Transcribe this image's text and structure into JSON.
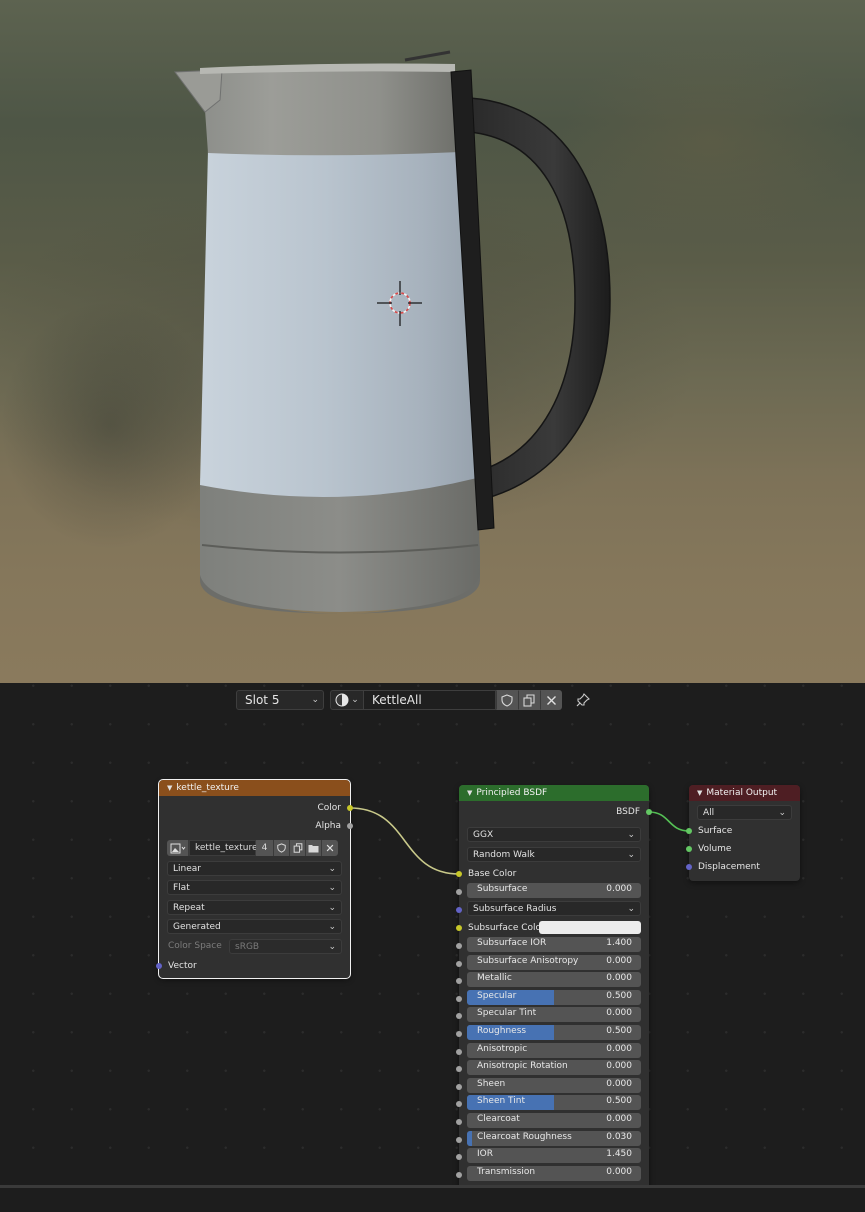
{
  "header": {
    "slot_label": "Slot 5",
    "material_name": "KettleAll"
  },
  "icons": {
    "material": "material-sphere-icon",
    "fake_user": "shield-icon",
    "duplicate": "duplicate-icon",
    "unlink": "close-icon",
    "pin": "pin-icon"
  },
  "nodes": {
    "image": {
      "title": "kettle_texture",
      "header_color": "#8a4f1c",
      "outputs": [
        "Color",
        "Alpha"
      ],
      "image_name": "kettle_texture",
      "users": "4",
      "interpolation": "Linear",
      "projection": "Flat",
      "extension": "Repeat",
      "source": "Generated",
      "color_space_label": "Color Space",
      "color_space": "sRGB",
      "input": "Vector"
    },
    "bsdf": {
      "title": "Principled BSDF",
      "header_color": "#2c6d2c",
      "output": "BSDF",
      "distribution": "GGX",
      "subsurface_method": "Random Walk",
      "base_color_label": "Base Color",
      "subsurface_radius_label": "Subsurface Radius",
      "subsurface_color_label": "Subsurface Color",
      "fields": [
        {
          "label": "Subsurface",
          "value": "0.000",
          "fill": 0
        },
        {
          "label": "Subsurface IOR",
          "value": "1.400",
          "fill": 0.0
        },
        {
          "label": "Subsurface Anisotropy",
          "value": "0.000",
          "fill": 0
        },
        {
          "label": "Metallic",
          "value": "0.000",
          "fill": 0
        },
        {
          "label": "Specular",
          "value": "0.500",
          "fill": 0.5
        },
        {
          "label": "Specular Tint",
          "value": "0.000",
          "fill": 0
        },
        {
          "label": "Roughness",
          "value": "0.500",
          "fill": 0.5
        },
        {
          "label": "Anisotropic",
          "value": "0.000",
          "fill": 0
        },
        {
          "label": "Anisotropic Rotation",
          "value": "0.000",
          "fill": 0
        },
        {
          "label": "Sheen",
          "value": "0.000",
          "fill": 0
        },
        {
          "label": "Sheen Tint",
          "value": "0.500",
          "fill": 0.5
        },
        {
          "label": "Clearcoat",
          "value": "0.000",
          "fill": 0
        },
        {
          "label": "Clearcoat Roughness",
          "value": "0.030",
          "fill": 0.03
        },
        {
          "label": "IOR",
          "value": "1.450",
          "fill": 0
        },
        {
          "label": "Transmission",
          "value": "0.000",
          "fill": 0
        }
      ]
    },
    "output": {
      "title": "Material Output",
      "header_color": "#4e1e23",
      "target": "All",
      "inputs": [
        "Surface",
        "Volume",
        "Displacement"
      ]
    }
  }
}
